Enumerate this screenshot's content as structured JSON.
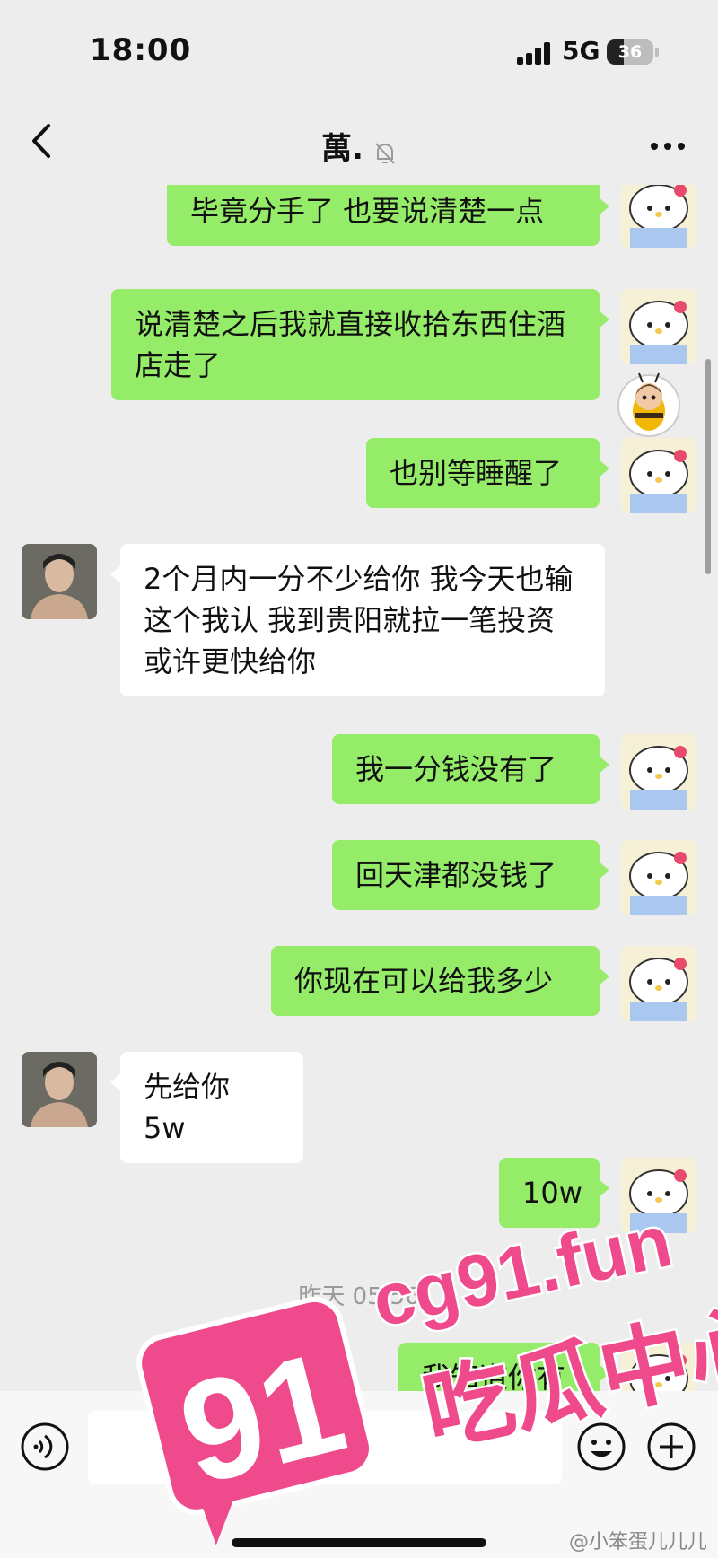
{
  "status_bar": {
    "time": "18:00",
    "network": "5G",
    "battery": "36",
    "battery_level": 0.36
  },
  "nav": {
    "back_icon": "chevron-left-icon",
    "title": "萬.",
    "mute_icon": "bell-off-icon",
    "more_icon": "more-dots-icon"
  },
  "messages": [
    {
      "side": "me",
      "text": "毕竟分手了 也要说清楚一点"
    },
    {
      "side": "me",
      "text": "说清楚之后我就直接收拾东西住酒店走了"
    },
    {
      "side": "me",
      "text": "也别等睡醒了"
    },
    {
      "side": "them",
      "text": "2个月内一分不少给你 我今天也输  这个我认 我到贵阳就拉一笔投资 或许更快给你"
    },
    {
      "side": "me",
      "text": "我一分钱没有了"
    },
    {
      "side": "me",
      "text": "回天津都没钱了"
    },
    {
      "side": "me",
      "text": "你现在可以给我多少"
    },
    {
      "side": "them",
      "text": "先给你 5w"
    },
    {
      "side": "me",
      "text": "10w"
    },
    {
      "side": "me",
      "text": "我知道你有"
    }
  ],
  "timestamp": "昨天 05:56",
  "input_bar": {
    "voice_icon": "voice-icon",
    "emoji_icon": "emoji-icon",
    "plus_icon": "plus-icon"
  },
  "watermark": {
    "site": "cg91.fun",
    "badge": "91",
    "caption": "吃瓜中心",
    "weibo": "@小笨蛋儿儿儿"
  },
  "colors": {
    "background": "#ededed",
    "my_bubble": "#95ec69",
    "their_bubble": "#ffffff",
    "watermark_pink": "#ef4a8c"
  }
}
